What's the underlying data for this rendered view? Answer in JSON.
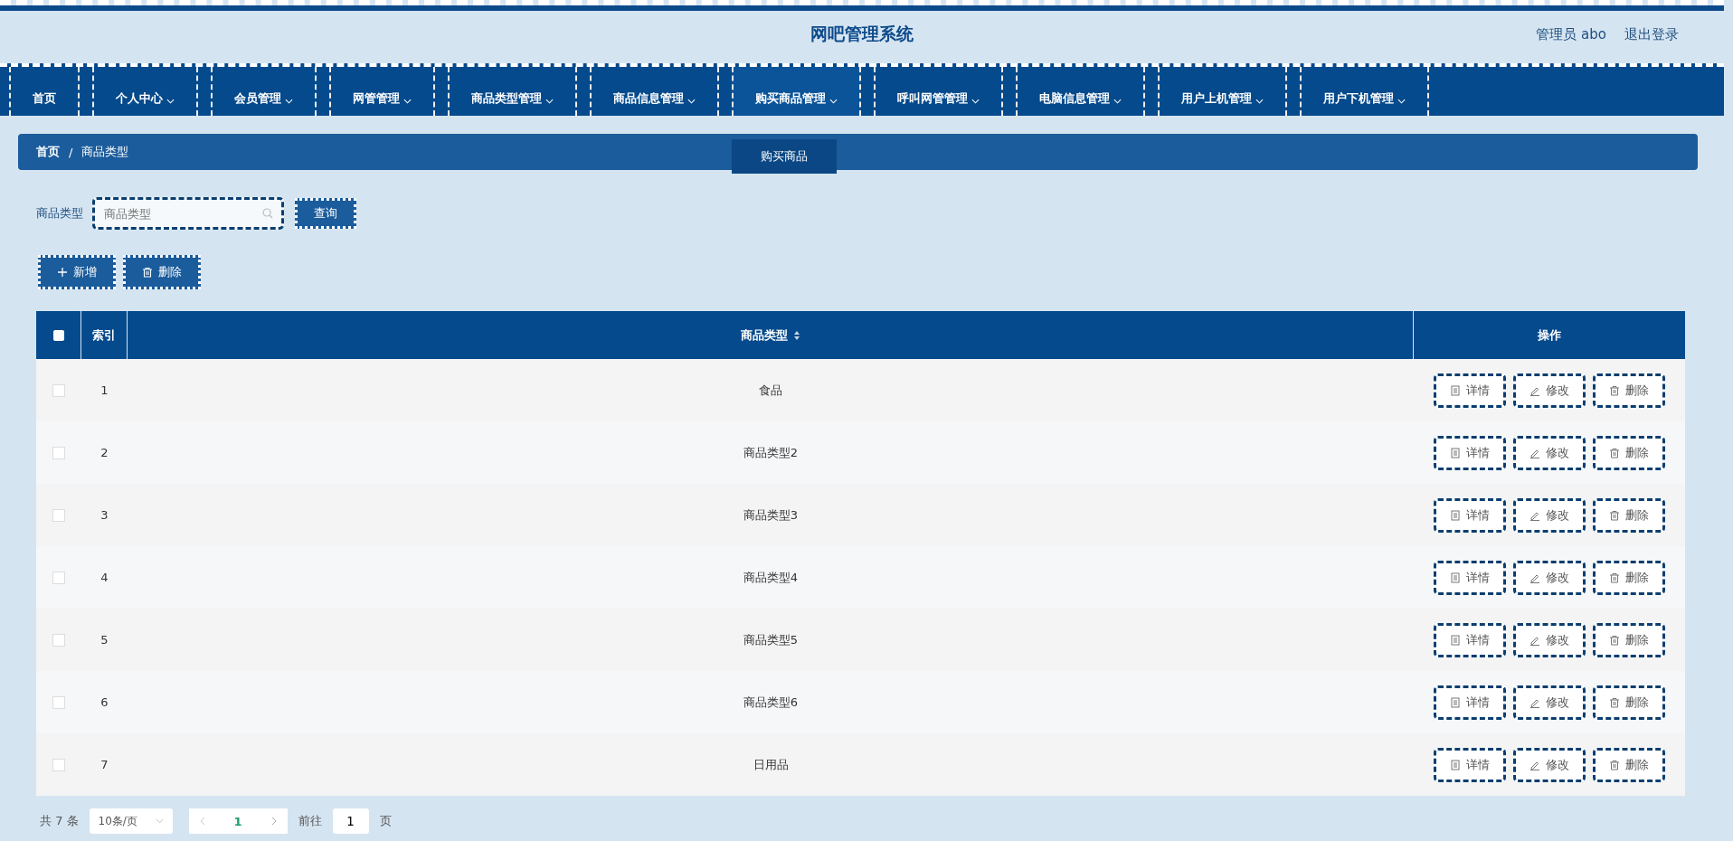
{
  "header": {
    "title": "网吧管理系统",
    "user": "管理员 abo",
    "logout": "退出登录"
  },
  "nav": [
    {
      "label": "首页",
      "caret": false,
      "expanded": false
    },
    {
      "label": "个人中心",
      "caret": true,
      "expanded": false
    },
    {
      "label": "会员管理",
      "caret": true,
      "expanded": false
    },
    {
      "label": "网管管理",
      "caret": true,
      "expanded": false
    },
    {
      "label": "商品类型管理",
      "caret": true,
      "expanded": false
    },
    {
      "label": "商品信息管理",
      "caret": true,
      "expanded": false
    },
    {
      "label": "购买商品管理",
      "caret": true,
      "expanded": true,
      "submenu": [
        "购买商品"
      ]
    },
    {
      "label": "呼叫网管管理",
      "caret": true,
      "expanded": false
    },
    {
      "label": "电脑信息管理",
      "caret": true,
      "expanded": false
    },
    {
      "label": "用户上机管理",
      "caret": true,
      "expanded": false
    },
    {
      "label": "用户下机管理",
      "caret": true,
      "expanded": false
    }
  ],
  "breadcrumb": [
    {
      "label": "首页",
      "separator": "/"
    },
    {
      "label": "商品类型"
    }
  ],
  "search": {
    "label": "商品类型",
    "placeholder": "商品类型",
    "button": "查询"
  },
  "actions": [
    {
      "kind": "add",
      "label": "新增"
    },
    {
      "kind": "delete",
      "label": "删除"
    }
  ],
  "table": {
    "header_checked": false,
    "columns": [
      "索引",
      "商品类型",
      "操作"
    ],
    "rows": [
      {
        "index": "1",
        "type": "食品",
        "checked": false,
        "buttons": [
          {
            "kind": "detail",
            "label": "详情"
          },
          {
            "kind": "edit",
            "label": "修改"
          },
          {
            "kind": "delete",
            "label": "删除"
          }
        ]
      },
      {
        "index": "2",
        "type": "商品类型2",
        "checked": false,
        "buttons": [
          {
            "kind": "detail",
            "label": "详情"
          },
          {
            "kind": "edit",
            "label": "修改"
          },
          {
            "kind": "delete",
            "label": "删除"
          }
        ]
      },
      {
        "index": "3",
        "type": "商品类型3",
        "checked": false,
        "buttons": [
          {
            "kind": "detail",
            "label": "详情"
          },
          {
            "kind": "edit",
            "label": "修改"
          },
          {
            "kind": "delete",
            "label": "删除"
          }
        ]
      },
      {
        "index": "4",
        "type": "商品类型4",
        "checked": false,
        "buttons": [
          {
            "kind": "detail",
            "label": "详情"
          },
          {
            "kind": "edit",
            "label": "修改"
          },
          {
            "kind": "delete",
            "label": "删除"
          }
        ]
      },
      {
        "index": "5",
        "type": "商品类型5",
        "checked": false,
        "buttons": [
          {
            "kind": "detail",
            "label": "详情"
          },
          {
            "kind": "edit",
            "label": "修改"
          },
          {
            "kind": "delete",
            "label": "删除"
          }
        ]
      },
      {
        "index": "6",
        "type": "商品类型6",
        "checked": false,
        "buttons": [
          {
            "kind": "detail",
            "label": "详情"
          },
          {
            "kind": "edit",
            "label": "修改"
          },
          {
            "kind": "delete",
            "label": "删除"
          }
        ]
      },
      {
        "index": "7",
        "type": "日用品",
        "checked": false,
        "buttons": [
          {
            "kind": "detail",
            "label": "详情"
          },
          {
            "kind": "edit",
            "label": "修改"
          },
          {
            "kind": "delete",
            "label": "删除"
          }
        ]
      }
    ]
  },
  "pagination": {
    "total": "共 7 条",
    "page_size": "10条/页",
    "pages": [
      {
        "label": "1",
        "selected": true
      }
    ],
    "goto": "前往",
    "goto_value": "1",
    "page_unit": "页"
  }
}
